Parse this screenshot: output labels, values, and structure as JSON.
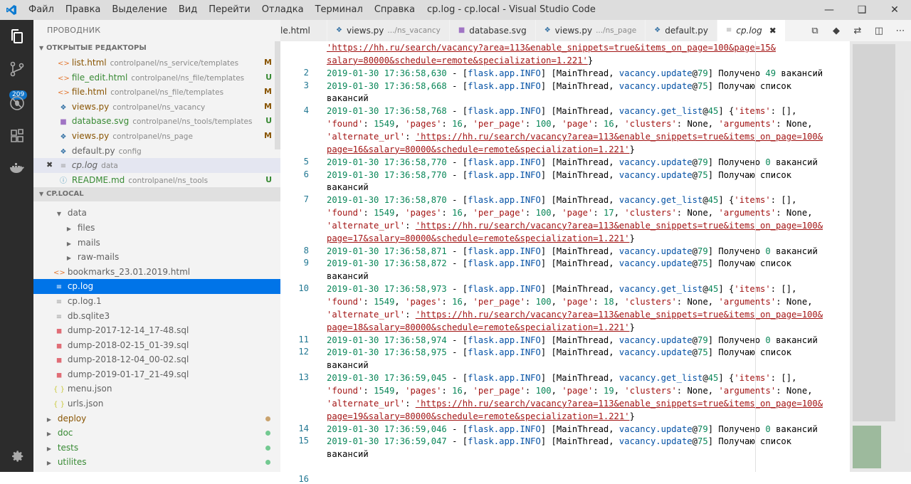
{
  "window": {
    "title": "cp.log - cp.local - Visual Studio Code",
    "menu": [
      "Файл",
      "Правка",
      "Выделение",
      "Вид",
      "Перейти",
      "Отладка",
      "Терминал",
      "Справка"
    ]
  },
  "activity": {
    "badge": "209"
  },
  "sidebar": {
    "title": "ПРОВОДНИК",
    "open_editors_title": "ОТКРЫТЫЕ РЕДАКТОРЫ",
    "open_editors": [
      {
        "name": "list.html",
        "path": "controlpanel/ns_service/templates",
        "status": "M",
        "icon": "html-icon",
        "cls": "m"
      },
      {
        "name": "file_edit.html",
        "path": "controlpanel/ns_file/templates",
        "status": "U",
        "icon": "html-icon",
        "cls": "u"
      },
      {
        "name": "file.html",
        "path": "controlpanel/ns_file/templates",
        "status": "M",
        "icon": "html-icon",
        "cls": "m"
      },
      {
        "name": "views.py",
        "path": "controlpanel/ns_vacancy",
        "status": "M",
        "icon": "python-icon",
        "cls": "m"
      },
      {
        "name": "database.svg",
        "path": "controlpanel/ns_tools/templates",
        "status": "U",
        "icon": "svg-icon",
        "cls": "u"
      },
      {
        "name": "views.py",
        "path": "controlpanel/ns_page",
        "status": "M",
        "icon": "python-icon",
        "cls": "m"
      },
      {
        "name": "default.py",
        "path": "config",
        "status": "",
        "icon": "python-icon",
        "cls": ""
      },
      {
        "name": "cp.log",
        "path": "data",
        "status": "",
        "icon": "log-icon",
        "cls": "",
        "active": true
      },
      {
        "name": "README.md",
        "path": "controlpanel/ns_tools",
        "status": "U",
        "icon": "info-icon",
        "cls": "u"
      }
    ],
    "workspace_title": "CP.LOCAL",
    "tree": [
      {
        "name": "data",
        "indent": 1,
        "kind": "folder-open"
      },
      {
        "name": "files",
        "indent": 2,
        "kind": "folder"
      },
      {
        "name": "mails",
        "indent": 2,
        "kind": "folder"
      },
      {
        "name": "raw-mails",
        "indent": 2,
        "kind": "folder"
      },
      {
        "name": "bookmarks_23.01.2019.html",
        "indent": 1,
        "kind": "html"
      },
      {
        "name": "cp.log",
        "indent": 1,
        "kind": "log",
        "selected": true
      },
      {
        "name": "cp.log.1",
        "indent": 1,
        "kind": "log"
      },
      {
        "name": "db.sqlite3",
        "indent": 1,
        "kind": "db"
      },
      {
        "name": "dump-2017-12-14_17-48.sql",
        "indent": 1,
        "kind": "sql"
      },
      {
        "name": "dump-2018-02-15_01-39.sql",
        "indent": 1,
        "kind": "sql"
      },
      {
        "name": "dump-2018-12-04_00-02.sql",
        "indent": 1,
        "kind": "sql"
      },
      {
        "name": "dump-2019-01-17_21-49.sql",
        "indent": 1,
        "kind": "sql"
      },
      {
        "name": "menu.json",
        "indent": 1,
        "kind": "json"
      },
      {
        "name": "urls.json",
        "indent": 1,
        "kind": "json"
      },
      {
        "name": "deploy",
        "indent": 0,
        "kind": "folder",
        "color": "#895503",
        "dot": "#c9a26d"
      },
      {
        "name": "doc",
        "indent": 0,
        "kind": "folder",
        "color": "#388a34",
        "dot": "#73c991"
      },
      {
        "name": "tests",
        "indent": 0,
        "kind": "folder",
        "color": "#388a34",
        "dot": "#73c991"
      },
      {
        "name": "utilites",
        "indent": 0,
        "kind": "folder",
        "color": "#388a34",
        "dot": "#73c991"
      }
    ]
  },
  "tabs": [
    {
      "label": "le.html",
      "path": "",
      "icon": "html-icon"
    },
    {
      "label": "views.py",
      "path": ".../ns_vacancy",
      "icon": "python-icon"
    },
    {
      "label": "database.svg",
      "path": "",
      "icon": "svg-icon"
    },
    {
      "label": "views.py",
      "path": ".../ns_page",
      "icon": "python-icon"
    },
    {
      "label": "default.py",
      "path": "",
      "icon": "python-icon"
    },
    {
      "label": "cp.log",
      "path": "",
      "icon": "log-icon",
      "active": true
    }
  ],
  "editor": {
    "lines": [
      {
        "n": "",
        "text": "'https://hh.ru/search/vacancy?area=113&enable_snippets=true&items_on_page=100&page=15&"
      },
      {
        "n": "",
        "text": "salary=80000&schedule=remote&specialization=1.221'}"
      },
      {
        "n": "2",
        "text": "2019-01-30 17:36:58,630 - [flask.app.INFO] [MainThread, vacancy.update@79] Получено 49 вакансий"
      },
      {
        "n": "3",
        "text": "2019-01-30 17:36:58,668 - [flask.app.INFO] [MainThread, vacancy.update@75] Получаю список"
      },
      {
        "n": "",
        "text": "вакансий"
      },
      {
        "n": "4",
        "text": "2019-01-30 17:36:58,768 - [flask.app.INFO] [MainThread, vacancy.get_list@45] {'items': [],"
      },
      {
        "n": "",
        "text": "'found': 1549, 'pages': 16, 'per_page': 100, 'page': 16, 'clusters': None, 'arguments': None,"
      },
      {
        "n": "",
        "text": "'alternate_url': 'https://hh.ru/search/vacancy?area=113&enable_snippets=true&items_on_page=100&"
      },
      {
        "n": "",
        "text": "page=16&salary=80000&schedule=remote&specialization=1.221'}"
      },
      {
        "n": "5",
        "text": "2019-01-30 17:36:58,770 - [flask.app.INFO] [MainThread, vacancy.update@79] Получено 0 вакансий"
      },
      {
        "n": "6",
        "text": "2019-01-30 17:36:58,770 - [flask.app.INFO] [MainThread, vacancy.update@75] Получаю список"
      },
      {
        "n": "",
        "text": "вакансий"
      },
      {
        "n": "7",
        "text": "2019-01-30 17:36:58,870 - [flask.app.INFO] [MainThread, vacancy.get_list@45] {'items': [],"
      },
      {
        "n": "",
        "text": "'found': 1549, 'pages': 16, 'per_page': 100, 'page': 17, 'clusters': None, 'arguments': None,"
      },
      {
        "n": "",
        "text": "'alternate_url': 'https://hh.ru/search/vacancy?area=113&enable_snippets=true&items_on_page=100&"
      },
      {
        "n": "",
        "text": "page=17&salary=80000&schedule=remote&specialization=1.221'}"
      },
      {
        "n": "8",
        "text": "2019-01-30 17:36:58,871 - [flask.app.INFO] [MainThread, vacancy.update@79] Получено 0 вакансий"
      },
      {
        "n": "9",
        "text": "2019-01-30 17:36:58,872 - [flask.app.INFO] [MainThread, vacancy.update@75] Получаю список"
      },
      {
        "n": "",
        "text": "вакансий"
      },
      {
        "n": "10",
        "text": "2019-01-30 17:36:58,973 - [flask.app.INFO] [MainThread, vacancy.get_list@45] {'items': [],"
      },
      {
        "n": "",
        "text": "'found': 1549, 'pages': 16, 'per_page': 100, 'page': 18, 'clusters': None, 'arguments': None,"
      },
      {
        "n": "",
        "text": "'alternate_url': 'https://hh.ru/search/vacancy?area=113&enable_snippets=true&items_on_page=100&"
      },
      {
        "n": "",
        "text": "page=18&salary=80000&schedule=remote&specialization=1.221'}"
      },
      {
        "n": "11",
        "text": "2019-01-30 17:36:58,974 - [flask.app.INFO] [MainThread, vacancy.update@79] Получено 0 вакансий"
      },
      {
        "n": "12",
        "text": "2019-01-30 17:36:58,975 - [flask.app.INFO] [MainThread, vacancy.update@75] Получаю список"
      },
      {
        "n": "",
        "text": "вакансий"
      },
      {
        "n": "13",
        "text": "2019-01-30 17:36:59,045 - [flask.app.INFO] [MainThread, vacancy.get_list@45] {'items': [],"
      },
      {
        "n": "",
        "text": "'found': 1549, 'pages': 16, 'per_page': 100, 'page': 19, 'clusters': None, 'arguments': None,"
      },
      {
        "n": "",
        "text": "'alternate_url': 'https://hh.ru/search/vacancy?area=113&enable_snippets=true&items_on_page=100&"
      },
      {
        "n": "",
        "text": "page=19&salary=80000&schedule=remote&specialization=1.221'}"
      },
      {
        "n": "14",
        "text": "2019-01-30 17:36:59,046 - [flask.app.INFO] [MainThread, vacancy.update@79] Получено 0 вакансий"
      },
      {
        "n": "15",
        "text": "2019-01-30 17:36:59,047 - [flask.app.INFO] [MainThread, vacancy.update@75] Получаю список"
      },
      {
        "n": "",
        "text": "вакансий"
      },
      {
        "n": "",
        "text": ""
      },
      {
        "n": "16",
        "text": ""
      }
    ]
  }
}
